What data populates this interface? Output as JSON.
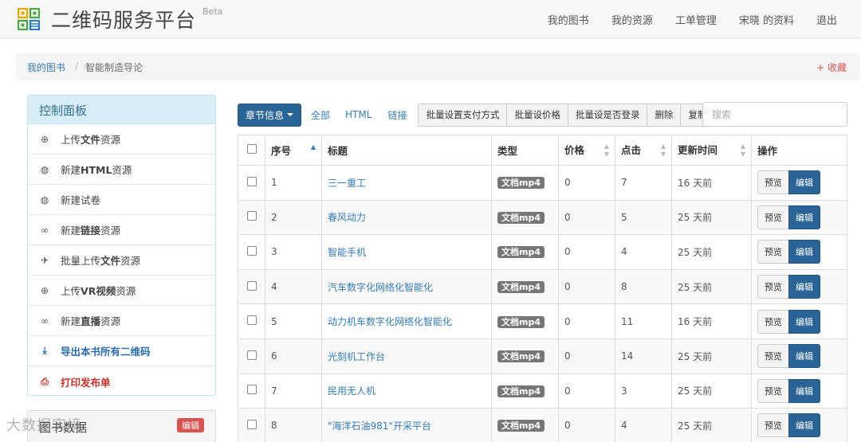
{
  "header": {
    "brand": "二维码服务平台",
    "beta": "Beta",
    "nav": [
      "我的图书",
      "我的资源",
      "工单管理",
      "宋晓 的资料",
      "退出"
    ]
  },
  "breadcrumb": {
    "home": "我的图书",
    "separator": "/",
    "current": "智能制造导论",
    "collect": "+ 收藏"
  },
  "panel": {
    "title": "控制面板",
    "items": [
      {
        "icon": "upload-circle-icon",
        "pre": "上传",
        "bold": "文件",
        "post": "资源"
      },
      {
        "icon": "globe-icon",
        "pre": "新建",
        "bold": "HTML",
        "post": "资源"
      },
      {
        "icon": "globe-icon",
        "pre": "新建试卷",
        "bold": "",
        "post": ""
      },
      {
        "icon": "link-icon",
        "pre": "新建",
        "bold": "链接",
        "post": "资源"
      },
      {
        "icon": "plane-icon",
        "pre": "批量上传",
        "bold": "文件",
        "post": "资源"
      },
      {
        "icon": "upload-circle-icon",
        "pre": "上传",
        "bold": "VR视频",
        "post": "资源"
      },
      {
        "icon": "link-icon",
        "pre": "新建",
        "bold": "直播",
        "post": "资源"
      },
      {
        "icon": "download-icon",
        "pre": "导出本书所有二维码",
        "bold": "",
        "post": ""
      },
      {
        "icon": "print-icon",
        "pre": "打印发布单",
        "bold": "",
        "post": ""
      }
    ]
  },
  "panel2": {
    "title": "图书数据",
    "badge": "编辑"
  },
  "toolbar": {
    "chapter": "章节信息",
    "filters": [
      "全部",
      "HTML",
      "链接"
    ],
    "batch": [
      "批量设置支付方式",
      "批量设价格",
      "批量设是否登录",
      "删除",
      "复制"
    ],
    "search_placeholder": "搜索"
  },
  "table": {
    "headers": [
      "序号",
      "标题",
      "类型",
      "价格",
      "点击",
      "更新时间",
      "操作"
    ],
    "rows": [
      {
        "no": "1",
        "title": "三一重工",
        "type": "文档mp4",
        "price": "0",
        "clicks": "7",
        "updated": "16 天前"
      },
      {
        "no": "2",
        "title": "春风动力",
        "type": "文档mp4",
        "price": "0",
        "clicks": "5",
        "updated": "25 天前"
      },
      {
        "no": "3",
        "title": "智能手机",
        "type": "文档mp4",
        "price": "0",
        "clicks": "4",
        "updated": "25 天前"
      },
      {
        "no": "4",
        "title": "汽车数字化网络化智能化",
        "type": "文档mp4",
        "price": "0",
        "clicks": "8",
        "updated": "25 天前"
      },
      {
        "no": "5",
        "title": "动力机车数字化网络化智能化",
        "type": "文档mp4",
        "price": "0",
        "clicks": "11",
        "updated": "16 天前"
      },
      {
        "no": "6",
        "title": "光刻机工作台",
        "type": "文档mp4",
        "price": "0",
        "clicks": "14",
        "updated": "25 天前"
      },
      {
        "no": "7",
        "title": "民用无人机",
        "type": "文档mp4",
        "price": "0",
        "clicks": "3",
        "updated": "25 天前"
      },
      {
        "no": "8",
        "title": "\"海洋石油981\"开采平台",
        "type": "文档mp4",
        "price": "0",
        "clicks": "4",
        "updated": "25 天前"
      }
    ],
    "preview_label": "预览",
    "edit_label": "编辑"
  },
  "watermark": "大数据实境"
}
